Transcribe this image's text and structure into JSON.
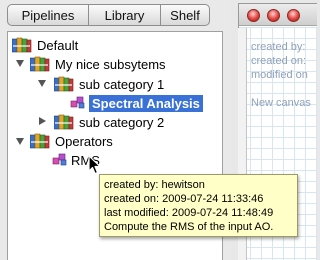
{
  "tabs": [
    "Pipelines",
    "Library",
    "Shelf"
  ],
  "tree": {
    "default": "Default",
    "subsystems": "My nice subsytems",
    "subcategory1": "sub category 1",
    "spectral": "Spectral Analysis",
    "subcategory2": "sub category 2",
    "operators": "Operators",
    "rms": "RMS"
  },
  "canvas": {
    "line1": "created by:",
    "line2": "created on:",
    "line3": "modified on",
    "line4": "New canvas"
  },
  "tooltip": {
    "line1": "created by: hewitson",
    "line2": "created on: 2009-07-24 11:33:46",
    "line3": "last modified: 2009-07-24 11:48:49",
    "line4": "Compute the RMS of the input AO."
  },
  "icons": {
    "folder": "folder-binders-icon",
    "block": "block-icon",
    "window_buttons": "traffic-light-icon"
  },
  "colors": {
    "selection": "#3a71d6",
    "tooltip_bg": "#ffffc7"
  }
}
